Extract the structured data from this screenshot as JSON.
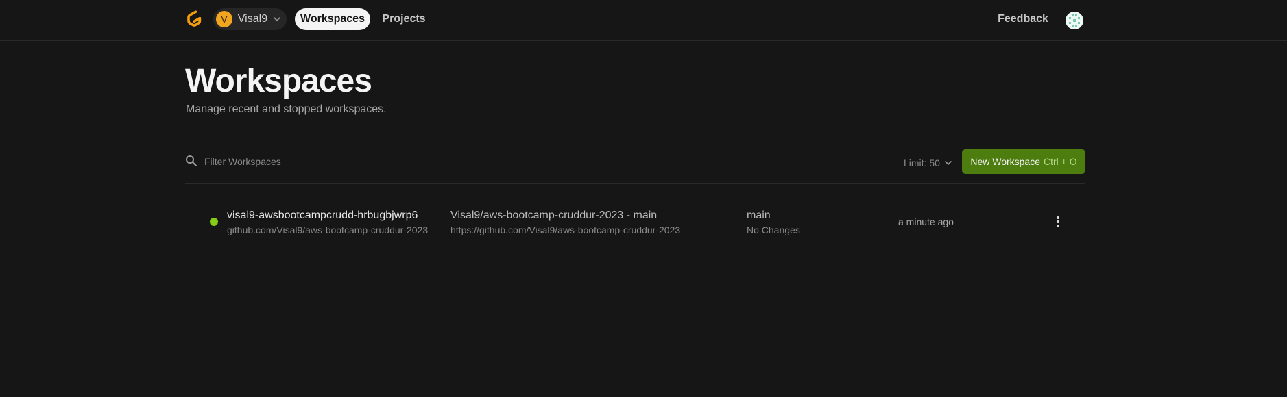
{
  "nav": {
    "org_initial": "V",
    "org_name": "Visal9",
    "tabs": [
      {
        "label": "Workspaces",
        "active": true
      },
      {
        "label": "Projects",
        "active": false
      }
    ],
    "feedback_label": "Feedback",
    "logo_icon": "gitpod-logo-icon",
    "avatar_icon": "user-avatar-icon"
  },
  "header": {
    "title": "Workspaces",
    "subtitle": "Manage recent and stopped workspaces."
  },
  "toolbar": {
    "filter_placeholder": "Filter Workspaces",
    "limit_label": "Limit: 50",
    "new_workspace_label": "New Workspace",
    "new_workspace_shortcut": "Ctrl + O"
  },
  "workspaces": [
    {
      "name": "visal9-awsbootcampcrudd-hrbugbjwrp6",
      "repo": "github.com/Visal9/aws-bootcamp-cruddur-2023",
      "context": "Visal9/aws-bootcamp-cruddur-2023 - main",
      "context_url": "https://github.com/Visal9/aws-bootcamp-cruddur-2023",
      "branch": "main",
      "changes": "No Changes",
      "last_active": "a minute ago",
      "status_color": "#84cc16"
    }
  ],
  "colors": {
    "background": "#161616",
    "accent_button": "#4d7c0f",
    "status_running": "#84cc16",
    "logo_orange": "#f59e0b"
  }
}
